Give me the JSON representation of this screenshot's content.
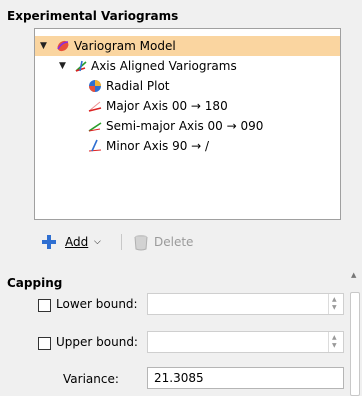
{
  "variograms": {
    "section_title": "Experimental Variograms",
    "tree": [
      {
        "label": "Variogram Model",
        "icon": "variogram-model-icon",
        "expanded": true,
        "selected": true
      },
      {
        "label": "Axis Aligned Variograms",
        "icon": "axis-aligned-icon",
        "expanded": true
      },
      {
        "label": "Radial Plot",
        "icon": "radial-plot-icon"
      },
      {
        "label": "Major Axis 00 → 180",
        "icon": "major-axis-icon"
      },
      {
        "label": "Semi-major Axis 00 → 090",
        "icon": "semi-major-axis-icon"
      },
      {
        "label": "Minor Axis 90 → /",
        "icon": "minor-axis-icon"
      }
    ],
    "toolbar": {
      "add_label": "Add",
      "delete_label": "Delete"
    }
  },
  "capping": {
    "section_title": "Capping",
    "lower_bound_label": "Lower bound:",
    "upper_bound_label": "Upper bound:",
    "variance_label": "Variance:",
    "variance_value": "21.3085",
    "lower_bound_value": "",
    "upper_bound_value": "",
    "lower_checked": false,
    "upper_checked": false
  },
  "colors": {
    "selection": "#fad5a0",
    "add_icon": "#2f6fd1"
  }
}
